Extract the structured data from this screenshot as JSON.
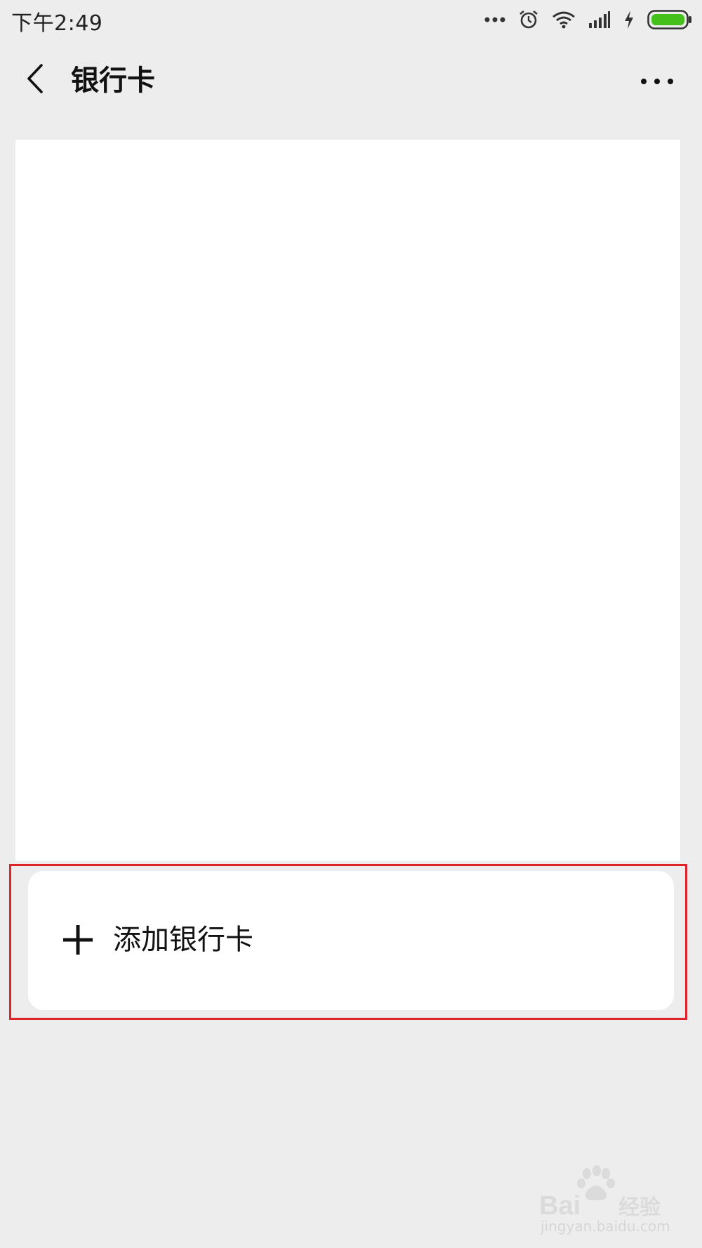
{
  "status_bar": {
    "time": "下午2:49",
    "icons": [
      "more-dots-icon",
      "alarm-icon",
      "wifi-icon",
      "signal-icon",
      "charging-icon",
      "battery-icon"
    ],
    "battery_color": "#45c01a"
  },
  "header": {
    "title": "银行卡",
    "back_icon": "chevron-left-icon",
    "more_icon": "more-horizontal-icon"
  },
  "add_card": {
    "label": "添加银行卡",
    "icon": "plus-icon"
  },
  "highlight_color": "#e0232b",
  "watermark": {
    "brand": "Baidu经验",
    "url": "jingyan.baidu.com"
  }
}
